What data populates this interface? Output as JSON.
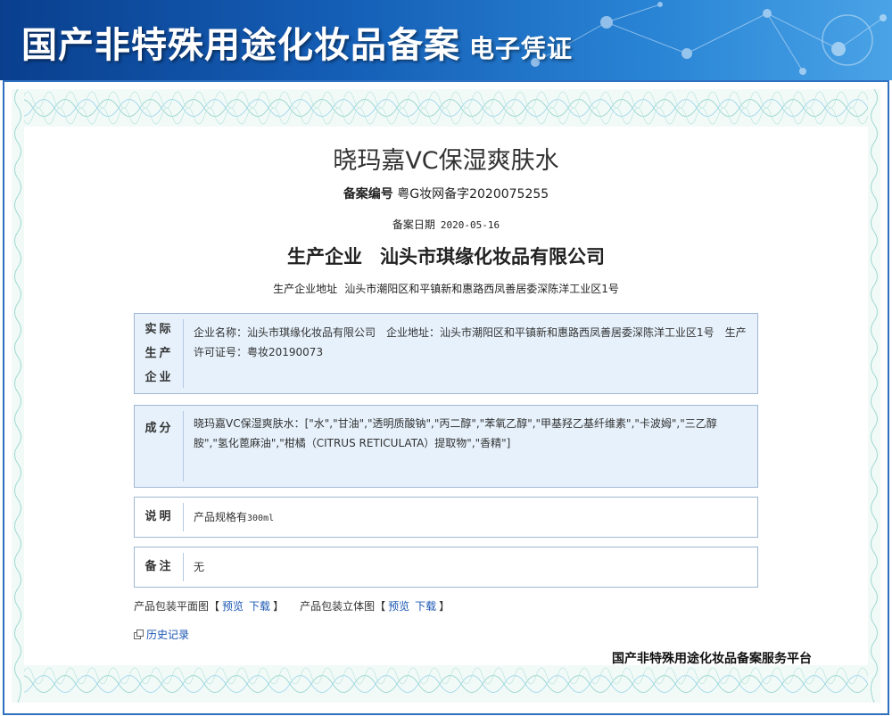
{
  "header": {
    "title": "国产非特殊用途化妆品备案",
    "subtitle": "电子凭证"
  },
  "product": {
    "name": "晓玛嘉VC保湿爽肤水",
    "registration_label": "备案编号",
    "registration_number": "粤G妆网备字2020075255",
    "date_label": "备案日期",
    "date": "2020-05-16",
    "producer_label": "生产企业",
    "producer": "汕头市琪缘化妆品有限公司",
    "producer_address_label": "生产企业地址",
    "producer_address": "汕头市潮阳区和平镇新和惠路西凤善居委深陈洋工业区1号"
  },
  "sections": {
    "actual": {
      "label_lines": [
        "实际",
        "生产",
        "企业"
      ],
      "content": "企业名称：汕头市琪缘化妆品有限公司　企业地址：汕头市潮阳区和平镇新和惠路西凤善居委深陈洋工业区1号　生产许可证号：粤妆20190073"
    },
    "ingredients": {
      "label": "成分",
      "content": "晓玛嘉VC保湿爽肤水：[\"水\",\"甘油\",\"透明质酸钠\",\"丙二醇\",\"苯氧乙醇\",\"甲基羟乙基纤维素\",\"卡波姆\",\"三乙醇胺\",\"氢化蓖麻油\",\"柑橘（CITRUS RETICULATA）提取物\",\"香精\"]"
    },
    "note": {
      "label": "说明",
      "content_prefix": "产品规格有",
      "content_value": "300ml"
    },
    "remark": {
      "label": "备注",
      "content": "无"
    }
  },
  "packaging": {
    "flat_label": "产品包装平面图",
    "solid_label": "产品包装立体图",
    "open_bracket": "【",
    "close_bracket": "】",
    "preview": "预览",
    "download": "下载"
  },
  "history_label": "历史记录",
  "platform": "国产非特殊用途化妆品备案服务平台",
  "colors": {
    "banner": "#1560b8",
    "frame": "#2f6fbf",
    "box_blue": "#e6f1fb",
    "link": "#1a56b3"
  }
}
